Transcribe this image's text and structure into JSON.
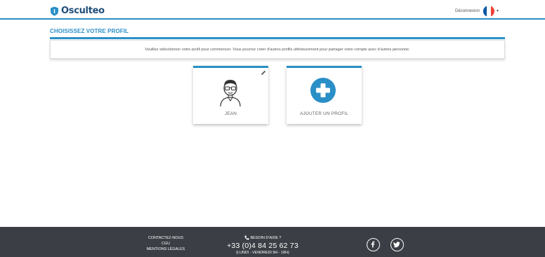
{
  "header": {
    "brand": "Osculteo",
    "logout_label": "Déconnexion",
    "language_caret": "▾",
    "flag_colors": [
      "#0055a4",
      "#ffffff",
      "#ef4135"
    ]
  },
  "main": {
    "title": "CHOISISSEZ VOTRE PROFIL",
    "info": "Veuillez sélectionner votre profil pour commencer. Vous pourrez créer d'autres profils ultérieurement pour partager votre compte avec d'autres personne."
  },
  "profiles": [
    {
      "name": "JEAN",
      "icon": "user-avatar-icon"
    },
    {
      "name": "AJOUTER UN PROFIL",
      "icon": "add-circle-icon"
    }
  ],
  "footer": {
    "links": [
      "CONTACTEZ-NOUS",
      "CGU",
      "MENTIONS LÉGALES"
    ],
    "help_title": "BESOIN D'AIDE ?",
    "phone": "+33 (0)4 84 25 62 73",
    "hours": "(LUNDI - VENDREDI 9H - 18H)"
  },
  "colors": {
    "accent": "#2a8fc7",
    "brand_dark": "#1f4e79",
    "footer_bg": "#3b3e44"
  }
}
